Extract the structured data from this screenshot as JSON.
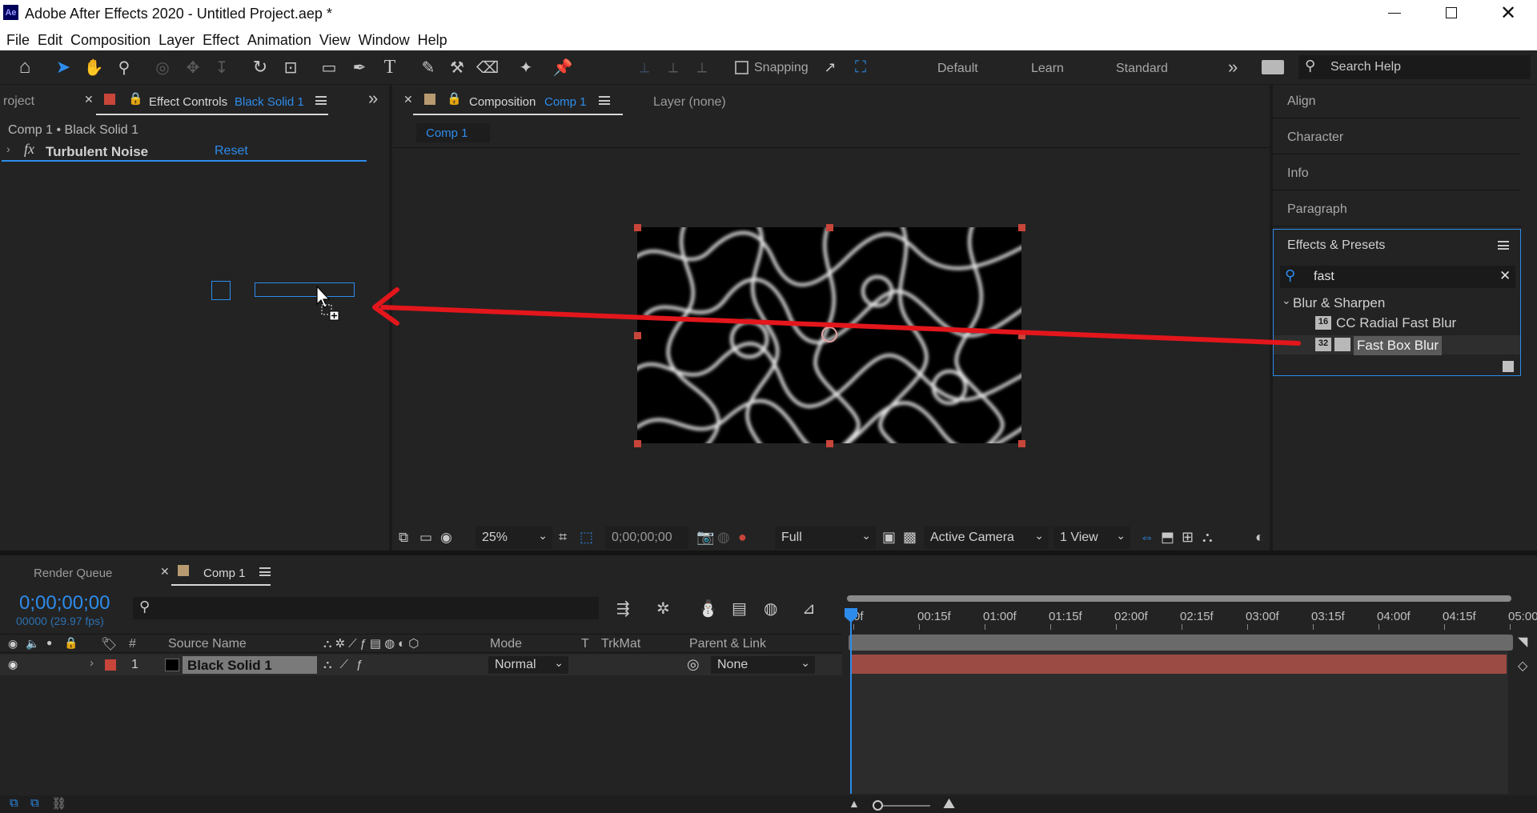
{
  "app": {
    "title": "Adobe After Effects 2020 - Untitled Project.aep *",
    "logo_text": "Ae",
    "window_controls": [
      "minimize-icon",
      "restore-icon",
      "close-icon"
    ]
  },
  "menu": [
    "File",
    "Edit",
    "Composition",
    "Layer",
    "Effect",
    "Animation",
    "View",
    "Window",
    "Help"
  ],
  "toolbar": {
    "snapping_label": "Snapping",
    "workspaces": [
      "Default",
      "Learn",
      "Standard"
    ],
    "search_placeholder": "Search Help"
  },
  "left_panel": {
    "project_tab": "roject",
    "effect_controls_tab": "Effect Controls",
    "effect_controls_target": "Black Solid 1",
    "breadcrumb": "Comp 1 • Black Solid 1",
    "effect_fx": "fx",
    "effect_name": "Turbulent Noise",
    "reset_label": "Reset"
  },
  "composition_panel": {
    "tab_label": "Composition",
    "tab_target": "Comp 1",
    "layer_label": "Layer (none)",
    "sub_tab": "Comp 1",
    "zoom": "25%",
    "timecode": "0;00;00;00",
    "resolution": "Full",
    "camera": "Active Camera",
    "views": "1 View"
  },
  "right_panels": {
    "collapsed": [
      "Align",
      "Character",
      "Info",
      "Paragraph"
    ],
    "effects_presets": {
      "title": "Effects & Presets",
      "search_value": "fast",
      "category": "Blur & Sharpen",
      "items": [
        {
          "badge": "16",
          "label": "CC Radial Fast Blur",
          "selected": false
        },
        {
          "badge": "32",
          "label": "Fast Box Blur",
          "selected": true
        }
      ]
    }
  },
  "timeline": {
    "render_queue_tab": "Render Queue",
    "comp_tab": "Comp 1",
    "current_time": "0;00;00;00",
    "frame_info": "00000 (29.97 fps)",
    "columns": [
      "#",
      "Source Name",
      "Mode",
      "T",
      "TrkMat",
      "Parent & Link"
    ],
    "ruler_ticks": [
      "0f",
      "00:15f",
      "01:00f",
      "01:15f",
      "02:00f",
      "02:15f",
      "03:00f",
      "03:15f",
      "04:00f",
      "04:15f",
      "05:00"
    ],
    "layers": [
      {
        "index": "1",
        "name": "Black Solid 1",
        "mode": "Normal",
        "parent": "None"
      }
    ]
  },
  "colors": {
    "accent_blue": "#2d8ceb",
    "label_red": "#c8453a",
    "layer_bar": "#9c4a44",
    "annotation_arrow": "#e3161c"
  }
}
